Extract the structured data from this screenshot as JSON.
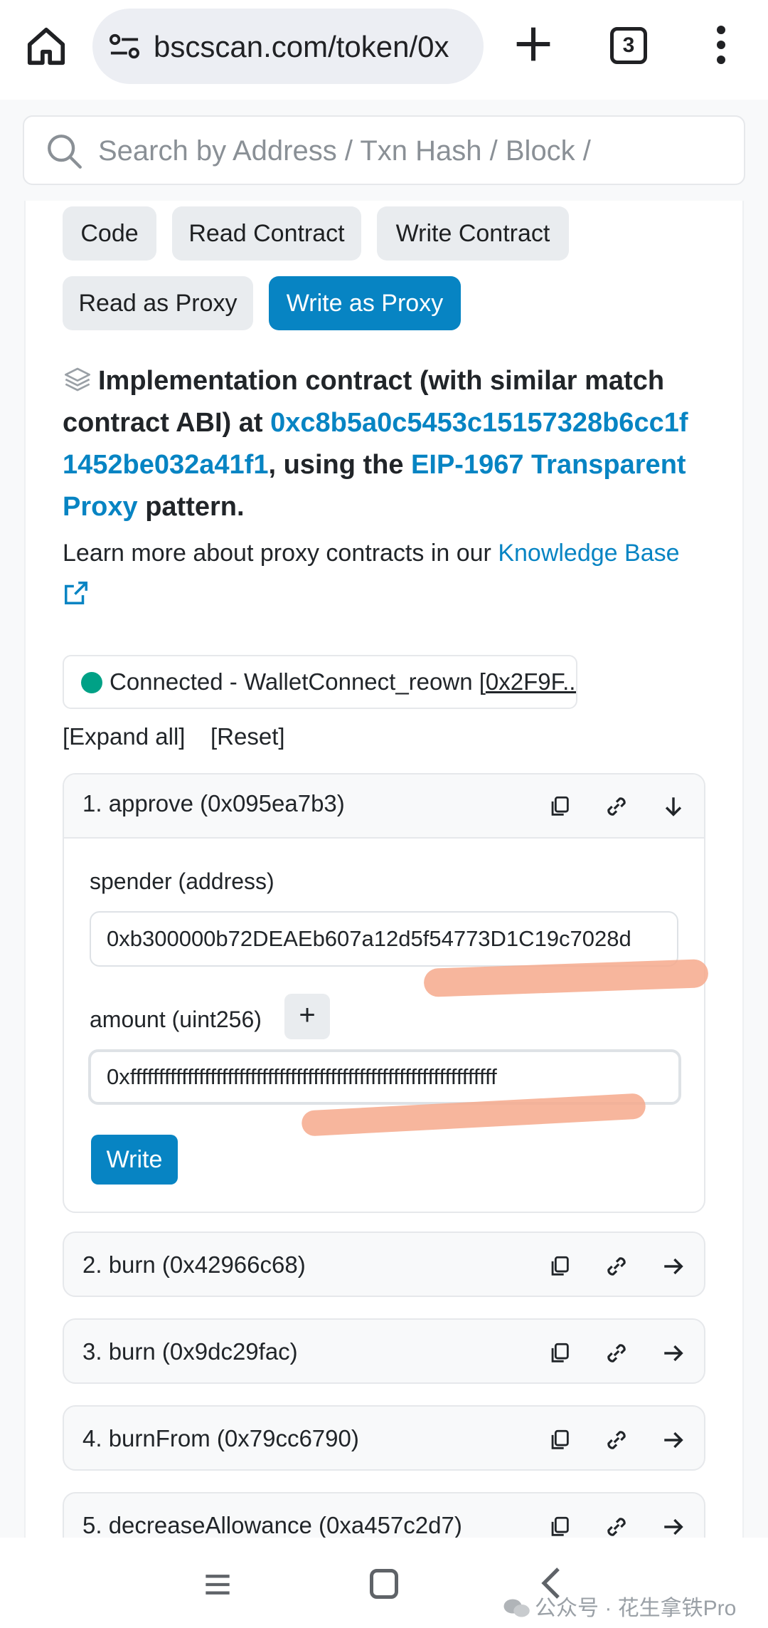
{
  "browser": {
    "url": "bscscan.com/token/0x",
    "tab_count": "3"
  },
  "search": {
    "placeholder": "Search by Address / Txn Hash / Block /"
  },
  "tabs": [
    {
      "label": "Code",
      "active": false
    },
    {
      "label": "Read Contract",
      "active": false
    },
    {
      "label": "Write Contract",
      "active": false
    },
    {
      "label": "Read as Proxy",
      "active": false
    },
    {
      "label": "Write as Proxy",
      "active": true
    }
  ],
  "implementation": {
    "prefix": "Implementation contract (with similar match contract ABI) at",
    "address": "0xc8b5a0c5453c15157328b6cc1f1452be032a41f1",
    "middle": ", using the",
    "pattern_link": "EIP-1967 Transparent Proxy",
    "suffix": "pattern.",
    "learn_text": "Learn more about proxy contracts in our",
    "learn_link": "Knowledge Base"
  },
  "wallet": {
    "status": "Connected - WalletConnect_reown",
    "address_short": "0x2F9F..."
  },
  "controls": {
    "expand_all": "[Expand all]",
    "reset": "[Reset]"
  },
  "methods": [
    {
      "title": "1. approve (0x095ea7b3)",
      "expanded": true
    },
    {
      "title": "2. burn (0x42966c68)",
      "expanded": false
    },
    {
      "title": "3. burn (0x9dc29fac)",
      "expanded": false
    },
    {
      "title": "4. burnFrom (0x79cc6790)",
      "expanded": false
    },
    {
      "title": "5. decreaseAllowance (0xa457c2d7)",
      "expanded": false
    }
  ],
  "approve_form": {
    "spender_label": "spender (address)",
    "spender_value": "0xb300000b72DEAEb607a12d5f54773D1C19c7028d",
    "amount_label": "amount (uint256)",
    "amount_value": "0xffffffffffffffffffffffffffffffffffffffffffffffffffffffffffffffff",
    "plus_label": "+",
    "write_label": "Write"
  },
  "watermark": "公众号 · 花生拿铁Pro",
  "colors": {
    "primary": "#0784c3",
    "connected_dot": "#00a186",
    "highlight": "#f6a98c"
  }
}
